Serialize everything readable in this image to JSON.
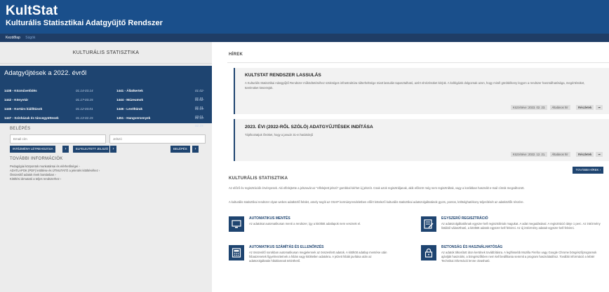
{
  "app": {
    "title": "KultStat",
    "subtitle": "Kulturális Statisztikai Adatgyűjtő Rendszer"
  },
  "nav": {
    "items": [
      "Kezdőlap",
      "Súgók"
    ]
  },
  "left": {
    "section_title": "KULTURÁLIS STATISZTIKA",
    "data_collection": {
      "title": "Adatgyűjtések a 2022. évről",
      "rows": [
        {
          "name1": "1438 - Közművelődés",
          "date1": "01.14-03.14",
          "name2": "1441 - Állatkertek",
          "date2": "01.02-01.31"
        },
        {
          "name1": "1442 - Könyvtár",
          "date1": "01.17-03.15",
          "name2": "1444 - Múzeumok",
          "date2": "01.02-01.31"
        },
        {
          "name1": "1445 - Kortárs kiállítások",
          "date1": "01.12-03.01",
          "name2": "1446 - Levéltárak",
          "date2": "01.19-03.01"
        },
        {
          "name1": "1447 - Színházak és táncegyüttesek",
          "date1": "01.13-02.15",
          "name2": "1451 - Hangversenyek",
          "date2": "01.10-02.15"
        }
      ]
    },
    "login": {
      "title": "BELÉPÉS",
      "email_placeholder": "Email cím",
      "password_placeholder": "Jelszó",
      "register_button": "INTÉZMÉNY LÉTREHOZÁSA",
      "forgot_button": "ELFELEJTETT JELSZÓ",
      "login_button": "BELÉPÉS"
    },
    "info": {
      "title": "TOVÁBBI INFORMÁCIÓK",
      "links": [
        "Pedagógiai központok munkatársai és elérhetőségei ›",
        "ADATLAPOK (PDF) letöltése és ÚTMUTATÓ a jelentés kitöltéséhez ›",
        "Összesítő adatok évek bontásban ›",
        "Kitöltési útmutató a teljes rendszerhez ›"
      ]
    }
  },
  "news": {
    "title": "HÍREK",
    "items": [
      {
        "title": "KULTSTAT RENDSZER LASSULÁS",
        "body": "A Kulturális Statisztikai Adatgyűjtő Rendszer működtetéséhez szükséges infrastruktúra túlterheltsége miatt lassulás tapasztalható, azért elnézésüket kérjük. A kollégáink dolgoznak azon, hogy minél gördülékeny legyen a rendszer használhatósága, megértésüket, türelmüket köszönjük.",
        "date": "Közzétéve: 2023. 02. 23.",
        "tag": "Általános hír",
        "more": "Részletek"
      },
      {
        "title": "2023. ÉVI (2022-RŐL SZÓLÓ) ADATGYŰJTÉSEK INDÍTÁSA",
        "body": "Tájékoztatjuk Önöket, hogy a január 31-ei határidejű",
        "date": "Közzétéve: 2022. 12. 21.",
        "tag": "Általános hír",
        "more": "Részletek"
      }
    ],
    "more_button": "TOVÁBBI HÍREK"
  },
  "kultstat": {
    "title": "KULTURÁLIS STATISZTIKA",
    "paragraphs": [
      "Az előző év regisztrációk érvényesek. Aki elfelejtette a jelszavát az \"elfelejtett jelszó\" gombbal kérhet új jelszót. Csak azok regisztráljanak, akik először még nem regisztráltak, vagy a korábban használt e-mail címük megváltozott.",
      "A kulturális statisztikai rendszer olyan webes adatközlő felület, amely segíti az OSAP kormányrendeletben előírt kötelező kulturális statisztikai adatszolgáltatások gyors, pontos, költséghatékony teljesítését az adatközlők részére."
    ],
    "features": [
      {
        "icon": "monitor-icon",
        "title": "AUTOMATIKUS MENTÉS",
        "body": "Az adatokat automatikusan menti a rendszer, így a kitöltött adatlapok nem vesznek el."
      },
      {
        "icon": "edit-icon",
        "title": "EGYSZERŰ REGISZTRÁCIÓ",
        "body": "Az adatszolgáltatóknak egyszer kell regisztrálniuk magukat. A adat megadásával. A regisztráció ideje 1 perc. Az intézmény listából választható, a kitöltött adatok egyszer kell felvinni. Az új intézmény adatait egyszer kell felvinni."
      },
      {
        "icon": "calculator-icon",
        "title": "AUTOMATIKUS SZÁMÍTÁS ÉS ELLENŐRZÉS",
        "body": "Az összesítő sorokban automatikusan megjelennek az összesített adatok. A kitöltött adatlap mentése után hibaüzenetek figyelmeztetnek a hibás vagy kitöltetlen adatokra. A jelzett hibák javítása után az adatszolgáltatás hibátlannak tekinthető."
      },
      {
        "icon": "lock-icon",
        "title": "BIZTONSÁG ÉS HASZNÁLHATÓSÁG",
        "body": "Az adatok titkosított úton kerülnek továbbításra. A legfrissebb Mozilla Firefox vagy Google Chrome böngészőprogramok ajánlják használni, a böngészőkben nem kell beállítania semmit a program használatához. További információ a lebtér Technikai információ lenne olvasható."
      }
    ]
  },
  "colors": {
    "brand": "#1a4f8b",
    "navy": "#1e4470",
    "panel": "#ececec"
  }
}
